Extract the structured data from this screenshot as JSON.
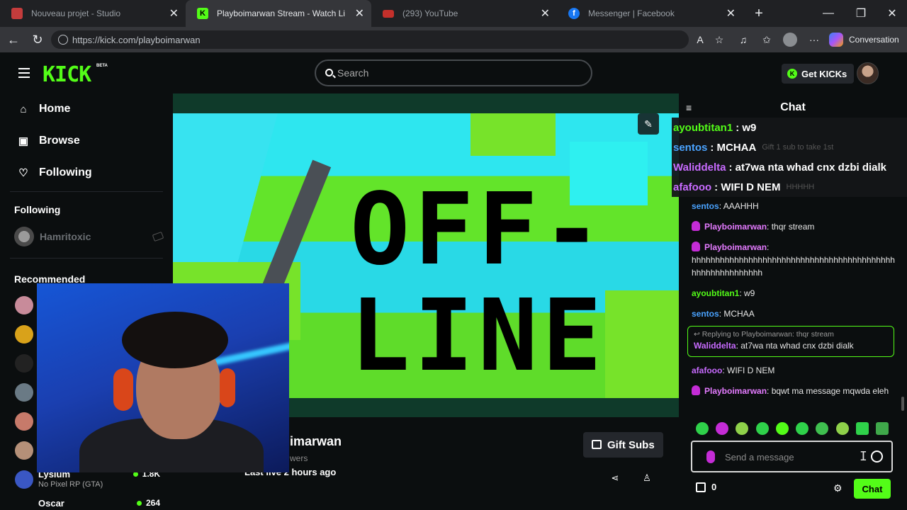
{
  "browser": {
    "tabs": [
      {
        "title": "Nouveau projet - Studio",
        "favicon": "studio-icon",
        "color": "#c43c3c",
        "active": false
      },
      {
        "title": "Playboimarwan Stream - Watch Li",
        "favicon": "kick-icon",
        "color": "#53fc18",
        "active": true
      },
      {
        "title": "(293) YouTube",
        "favicon": "youtube-icon",
        "color": "#c4302b",
        "active": false
      },
      {
        "title": "Messenger | Facebook",
        "favicon": "facebook-icon",
        "color": "#1877f2",
        "active": false
      }
    ],
    "url": "https://kick.com/playboimarwan",
    "conversation_label": "Conversation"
  },
  "header": {
    "logo": "KICK",
    "beta": "BETA",
    "search_placeholder": "Search",
    "get_kicks": "Get KICKs"
  },
  "sidebar": {
    "nav": [
      {
        "label": "Home",
        "icon": "home-icon"
      },
      {
        "label": "Browse",
        "icon": "browse-icon"
      },
      {
        "label": "Following",
        "icon": "heart-icon"
      }
    ],
    "following_heading": "Following",
    "following": [
      {
        "name": "Hamritoxic"
      }
    ],
    "recommended_heading": "Recommended",
    "channels": [
      {
        "name": "Lysium",
        "category": "No Pixel RP (GTA)",
        "viewers": "1.8K"
      },
      {
        "name": "Oscar",
        "category": "",
        "viewers": "264"
      }
    ]
  },
  "player": {
    "offline_text_1": "OFF-",
    "offline_text_2": "LINE"
  },
  "stream_info": {
    "streamer": "imarwan",
    "viewers": "wers",
    "last_live": "Last live 2 hours ago",
    "gift_subs": "Gift Subs"
  },
  "chat": {
    "title": "Chat",
    "pinned": [
      {
        "user": "ayoubtitan1",
        "color": "#53fc18",
        "text": ": w9",
        "ghost": ""
      },
      {
        "user": "sentos",
        "color": "#4aa3ff",
        "text": ": MCHAA",
        "ghost": "Gift 1 sub to take 1st"
      },
      {
        "user": "Waliddelta",
        "color": "#c86bff",
        "text": ": at7wa nta whad cnx dzbi dialk",
        "ghost": ""
      },
      {
        "user": "afafooo",
        "color": "#c86bff",
        "text": ": WIFI D NEM",
        "ghost": "HHHHH"
      }
    ],
    "messages": [
      {
        "user": "sentos",
        "color": "#4aa3ff",
        "badge": false,
        "text": ": AAAHHH"
      },
      {
        "user": "Playboimarwan",
        "color": "#e47bff",
        "badge": true,
        "text": ": thqr stream"
      },
      {
        "user": "Playboimarwan",
        "color": "#e47bff",
        "badge": true,
        "text": ": hhhhhhhhhhhhhhhhhhhhhhhhhhhhhhhhhhhhhhhhhhhhhhhhhhhhhhhhhh"
      },
      {
        "user": "ayoubtitan1",
        "color": "#53fc18",
        "badge": false,
        "text": ": w9"
      },
      {
        "user": "sentos",
        "color": "#4aa3ff",
        "badge": false,
        "text": ": MCHAA"
      }
    ],
    "reply": {
      "context": "Replying to Playboimarwan: thqr stream",
      "user": "Waliddelta",
      "color": "#c86bff",
      "text": ": at7wa nta whad cnx dzbi dialk"
    },
    "messages_after": [
      {
        "user": "afafooo",
        "color": "#c86bff",
        "badge": false,
        "text": ": WIFI D NEM"
      },
      {
        "user": "Playboimarwan",
        "color": "#e47bff",
        "badge": true,
        "text": ": bqwt ma message mqwda eleh"
      }
    ],
    "input_placeholder": "Send a message",
    "points": "0",
    "send_label": "Chat"
  }
}
